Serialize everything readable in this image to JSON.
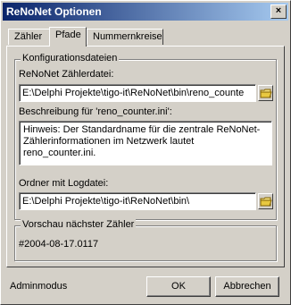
{
  "window": {
    "title": "ReNoNet Optionen",
    "close_label": "×"
  },
  "tabs": [
    {
      "label": "Zähler"
    },
    {
      "label": "Pfade"
    },
    {
      "label": "Nummernkreise"
    }
  ],
  "config_group": {
    "legend": "Konfigurationsdateien",
    "counter_file_label": "ReNoNet Zählerdatei:",
    "counter_file_value": "E:\\Delphi Projekte\\tigo-it\\ReNoNet\\bin\\reno_counte",
    "description_label": "Beschreibung für 'reno_counter.ini':",
    "description_text": "Hinweis: Der Standardname für die zentrale ReNoNet-Zählerinformationen im Netzwerk lautet reno_counter.ini.",
    "log_folder_label": "Ordner mit Logdatei:",
    "log_folder_value": "E:\\Delphi Projekte\\tigo-it\\ReNoNet\\bin\\"
  },
  "preview_group": {
    "legend": "Vorschau nächster Zähler",
    "value": "#2004-08-17.0117"
  },
  "footer": {
    "mode_label": "Adminmodus",
    "ok_label": "OK",
    "cancel_label": "Abbrechen"
  }
}
